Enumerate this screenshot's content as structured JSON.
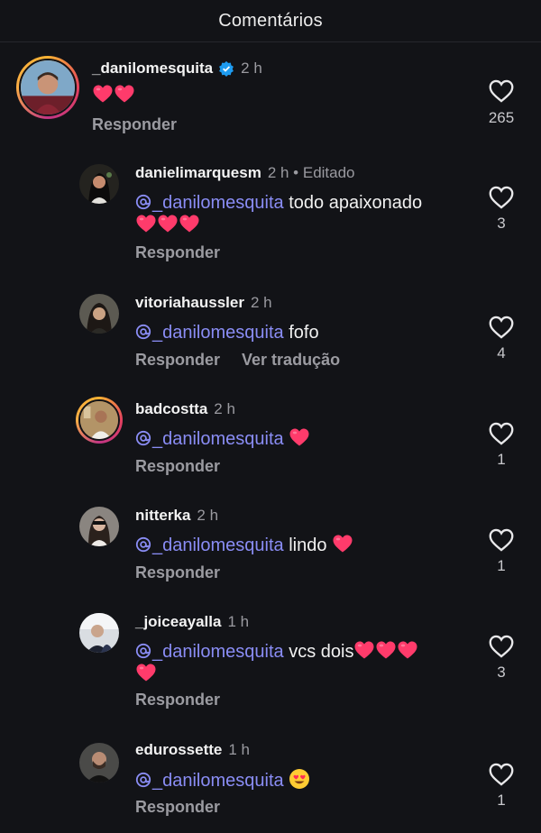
{
  "header": {
    "title": "Comentários"
  },
  "comments": [
    {
      "username": "_danilomesquita",
      "time": "2 h",
      "verified": true,
      "emoji_text": "❤️❤️",
      "reply_label": "Responder",
      "likes": "265"
    },
    {
      "username": "danielimarquesm",
      "time": "2 h • Editado",
      "mention": "_danilomesquita",
      "text": " todo apaixonado",
      "reply_label": "Responder",
      "likes": "3"
    },
    {
      "username": "vitoriahaussler",
      "time": "2 h",
      "mention": "_danilomesquita",
      "text": " fofo",
      "reply_label": "Responder",
      "translate_label": "Ver tradução",
      "likes": "4"
    },
    {
      "username": "badcostta",
      "time": "2 h",
      "mention": "_danilomesquita",
      "text": "",
      "reply_label": "Responder",
      "likes": "1"
    },
    {
      "username": "nitterka",
      "time": "2 h",
      "mention": "_danilomesquita",
      "text": " lindo",
      "reply_label": "Responder",
      "likes": "1"
    },
    {
      "username": "_joiceayalla",
      "time": "1 h",
      "mention": "_danilomesquita",
      "text": " vcs dois",
      "reply_label": "Responder",
      "likes": "3"
    },
    {
      "username": "edurossette",
      "time": "1 h",
      "mention": "_danilomesquita",
      "text": "",
      "reply_label": "Responder",
      "likes": "1"
    }
  ],
  "colors": {
    "background": "#121317",
    "mention": "#8a8df5",
    "heart": "#ff3b6b",
    "verified": "#1d9bf0"
  }
}
